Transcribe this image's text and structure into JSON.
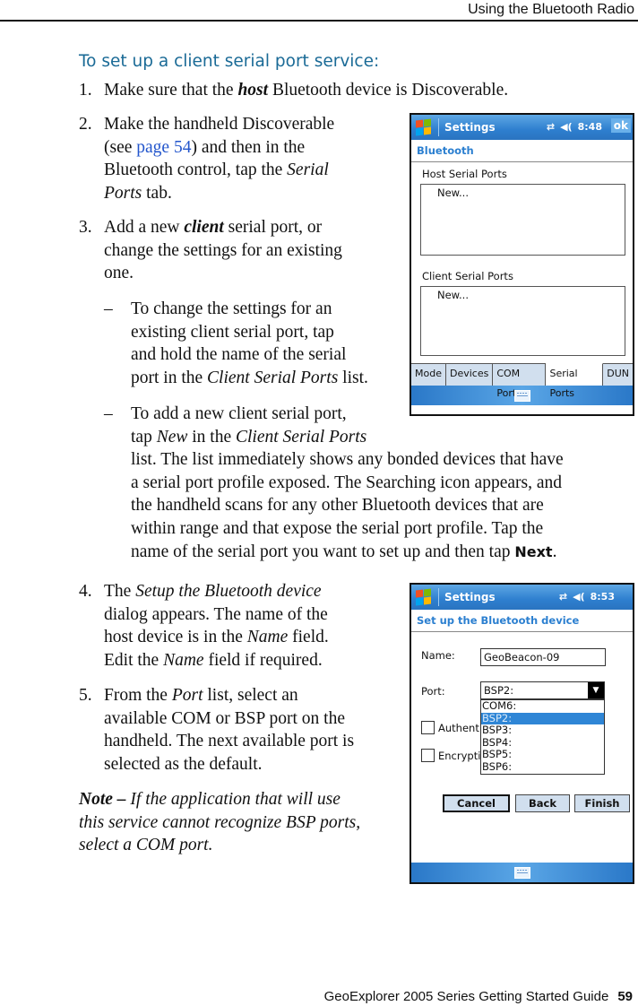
{
  "header": {
    "running_title": "Using the Bluetooth Radio"
  },
  "section": {
    "title": "To set up a client serial port service:"
  },
  "steps": {
    "s1": {
      "num": "1.",
      "pre": "Make sure that the ",
      "emph": "host",
      "post": " Bluetooth device is Discoverable."
    },
    "s2": {
      "num": "2.",
      "l1": "Make the handheld Discoverable",
      "l2_pre": "(see ",
      "l2_link": "page 54",
      "l2_post": ") and then in the",
      "l3_pre": "Bluetooth control, tap the ",
      "l3_em": "Serial",
      "l4_em": "Ports",
      "l4_post": " tab."
    },
    "s3": {
      "num": "3.",
      "l1_pre": "Add a new ",
      "l1_emph": "client",
      "l1_post": " serial port, or",
      "l2": "change the settings for an existing",
      "l3": "one."
    },
    "d1": {
      "mark": "–",
      "l1": "To change the settings for an",
      "l2": "existing client serial port, tap",
      "l3": "and hold the name of the serial",
      "l4_pre": "port in the ",
      "l4_em": "Client Serial Ports",
      "l4_post": " list."
    },
    "d2": {
      "mark": "–",
      "l1": "To add a new client serial port,",
      "l2_pre": "tap ",
      "l2_em1": "New",
      "l2_mid": " in the ",
      "l2_em2": "Client Serial Ports",
      "l3": "list. The list immediately shows any bonded devices that have",
      "l4": "a serial port profile exposed. The Searching icon appears, and",
      "l5": "the handheld scans for any other Bluetooth devices that are",
      "l6": "within range and that expose the serial port profile. Tap the",
      "l7_pre": "name of the serial port you want to set up and then tap ",
      "l7_bold": "Next",
      "l7_post": "."
    },
    "s4": {
      "num": "4.",
      "l1_pre": "The ",
      "l1_em": "Setup the Bluetooth device",
      "l2": "dialog appears. The name of the",
      "l3_pre": "host device is in the ",
      "l3_em": "Name",
      "l3_post": " field.",
      "l4_pre": "Edit the ",
      "l4_em": "Name",
      "l4_post": " field if required."
    },
    "s5": {
      "num": "5.",
      "l1_pre": "From the ",
      "l1_em": "Port",
      "l1_post": " list, select an",
      "l2": "available COM or BSP port on the",
      "l3": "handheld. The next available port is",
      "l4": "selected as the default."
    }
  },
  "note": {
    "label": "Note – ",
    "l1": "If the application that will use",
    "l2": "this service cannot recognize BSP ports,",
    "l3": "select a COM port."
  },
  "screen1": {
    "title": "Settings",
    "time": "8:48",
    "ok": "ok",
    "subtitle": "Bluetooth",
    "host_label": "Host Serial Ports",
    "host_item": "New...",
    "client_label": "Client Serial Ports",
    "client_item": "New...",
    "tabs": [
      "Mode",
      "Devices",
      "COM Ports",
      "Serial Ports",
      "DUN"
    ],
    "active_tab": "Serial Ports"
  },
  "screen2": {
    "title": "Settings",
    "time": "8:53",
    "subtitle": "Set up the Bluetooth device",
    "name_label": "Name:",
    "name_value": "GeoBeacon-09",
    "port_label": "Port:",
    "port_value": "BSP2:",
    "port_options": [
      "COM6:",
      "BSP2:",
      "BSP3:",
      "BSP4:",
      "BSP5:",
      "BSP6:"
    ],
    "auth_label": "Authent",
    "enc_label": "Encrypti",
    "buttons": {
      "cancel": "Cancel",
      "back": "Back",
      "finish": "Finish"
    }
  },
  "footer": {
    "guide": "GeoExplorer 2005 Series Getting Started Guide",
    "page": "59"
  },
  "colors": {
    "heading": "#1a6a96",
    "link": "#2255cc",
    "titlebar": "#2e7fcf",
    "selection": "#2f86d6"
  }
}
